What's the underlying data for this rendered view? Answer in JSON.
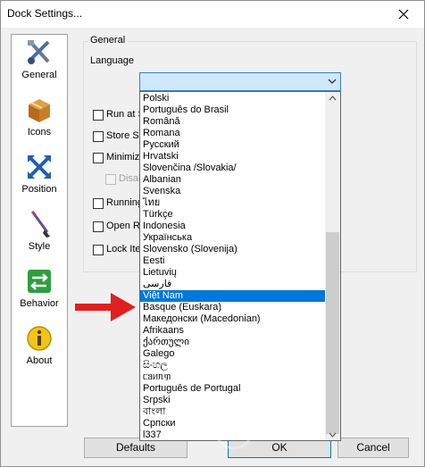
{
  "window": {
    "title": "Dock Settings..."
  },
  "sidebar": {
    "items": [
      {
        "label": "General",
        "icon": "tools-icon"
      },
      {
        "label": "Icons",
        "icon": "box-icon"
      },
      {
        "label": "Position",
        "icon": "move-arrows-icon"
      },
      {
        "label": "Style",
        "icon": "brush-icon"
      },
      {
        "label": "Behavior",
        "icon": "swap-arrows-icon"
      },
      {
        "label": "About",
        "icon": "info-icon"
      }
    ]
  },
  "general": {
    "group_label": "General",
    "language_label": "Language",
    "options": [
      {
        "label": "Run at S",
        "checked": false,
        "enabled": true
      },
      {
        "label": "Store Se",
        "checked": false,
        "enabled": true
      },
      {
        "label": "Minimize",
        "checked": false,
        "enabled": true
      },
      {
        "label": "Disab",
        "checked": false,
        "enabled": false
      },
      {
        "label": "Running",
        "checked": false,
        "enabled": true
      },
      {
        "label": "Open Ru",
        "checked": false,
        "enabled": true
      },
      {
        "label": "Lock Ite",
        "checked": false,
        "enabled": true
      }
    ]
  },
  "language_dropdown": {
    "selected_index": 17,
    "items": [
      "Polski",
      "Português do Brasil",
      "Română",
      "Romana",
      "Русский",
      "Hrvatski",
      "Slovenčina /Slovakia/",
      "Albanian",
      "Svenska",
      "ไทย",
      "Türkçe",
      "Indonesia",
      "Українська",
      "Slovensko (Slovenija)",
      "Eesti",
      "Lietuvių",
      "فارسی",
      "Việt Nam",
      "Basque (Euskara)",
      "Македонски (Macedonian)",
      "Afrikaans",
      "ქართული",
      "Galego",
      "සිංහල",
      "ᥴᥑᥢᥰᥞ",
      "Português de Portugal",
      "Srpski",
      "বাংলা",
      "Српски",
      "l337"
    ]
  },
  "buttons": {
    "defaults": "Defaults",
    "ok": "OK",
    "cancel": "Cancel"
  },
  "colors": {
    "highlight": "#0078d7",
    "arrow": "#e02020"
  }
}
